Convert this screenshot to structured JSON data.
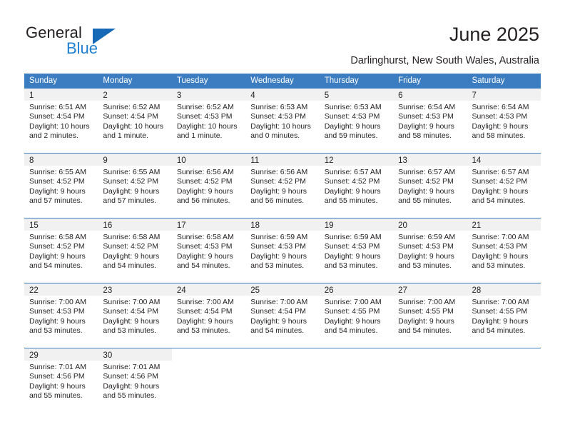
{
  "brand": {
    "name_top": "General",
    "name_bottom": "Blue",
    "accent_color": "#1669b6",
    "blue_text_color": "#1f7fd1"
  },
  "header": {
    "title": "June 2025",
    "subtitle": "Darlinghurst, New South Wales, Australia"
  },
  "calendar": {
    "header_bg": "#3b7dc0",
    "day_band_bg": "#f1f1f1",
    "weekdays": [
      "Sunday",
      "Monday",
      "Tuesday",
      "Wednesday",
      "Thursday",
      "Friday",
      "Saturday"
    ],
    "weeks": [
      [
        {
          "day": "1",
          "lines": [
            "Sunrise: 6:51 AM",
            "Sunset: 4:54 PM",
            "Daylight: 10 hours",
            "and 2 minutes."
          ]
        },
        {
          "day": "2",
          "lines": [
            "Sunrise: 6:52 AM",
            "Sunset: 4:54 PM",
            "Daylight: 10 hours",
            "and 1 minute."
          ]
        },
        {
          "day": "3",
          "lines": [
            "Sunrise: 6:52 AM",
            "Sunset: 4:53 PM",
            "Daylight: 10 hours",
            "and 1 minute."
          ]
        },
        {
          "day": "4",
          "lines": [
            "Sunrise: 6:53 AM",
            "Sunset: 4:53 PM",
            "Daylight: 10 hours",
            "and 0 minutes."
          ]
        },
        {
          "day": "5",
          "lines": [
            "Sunrise: 6:53 AM",
            "Sunset: 4:53 PM",
            "Daylight: 9 hours",
            "and 59 minutes."
          ]
        },
        {
          "day": "6",
          "lines": [
            "Sunrise: 6:54 AM",
            "Sunset: 4:53 PM",
            "Daylight: 9 hours",
            "and 58 minutes."
          ]
        },
        {
          "day": "7",
          "lines": [
            "Sunrise: 6:54 AM",
            "Sunset: 4:53 PM",
            "Daylight: 9 hours",
            "and 58 minutes."
          ]
        }
      ],
      [
        {
          "day": "8",
          "lines": [
            "Sunrise: 6:55 AM",
            "Sunset: 4:52 PM",
            "Daylight: 9 hours",
            "and 57 minutes."
          ]
        },
        {
          "day": "9",
          "lines": [
            "Sunrise: 6:55 AM",
            "Sunset: 4:52 PM",
            "Daylight: 9 hours",
            "and 57 minutes."
          ]
        },
        {
          "day": "10",
          "lines": [
            "Sunrise: 6:56 AM",
            "Sunset: 4:52 PM",
            "Daylight: 9 hours",
            "and 56 minutes."
          ]
        },
        {
          "day": "11",
          "lines": [
            "Sunrise: 6:56 AM",
            "Sunset: 4:52 PM",
            "Daylight: 9 hours",
            "and 56 minutes."
          ]
        },
        {
          "day": "12",
          "lines": [
            "Sunrise: 6:57 AM",
            "Sunset: 4:52 PM",
            "Daylight: 9 hours",
            "and 55 minutes."
          ]
        },
        {
          "day": "13",
          "lines": [
            "Sunrise: 6:57 AM",
            "Sunset: 4:52 PM",
            "Daylight: 9 hours",
            "and 55 minutes."
          ]
        },
        {
          "day": "14",
          "lines": [
            "Sunrise: 6:57 AM",
            "Sunset: 4:52 PM",
            "Daylight: 9 hours",
            "and 54 minutes."
          ]
        }
      ],
      [
        {
          "day": "15",
          "lines": [
            "Sunrise: 6:58 AM",
            "Sunset: 4:52 PM",
            "Daylight: 9 hours",
            "and 54 minutes."
          ]
        },
        {
          "day": "16",
          "lines": [
            "Sunrise: 6:58 AM",
            "Sunset: 4:52 PM",
            "Daylight: 9 hours",
            "and 54 minutes."
          ]
        },
        {
          "day": "17",
          "lines": [
            "Sunrise: 6:58 AM",
            "Sunset: 4:53 PM",
            "Daylight: 9 hours",
            "and 54 minutes."
          ]
        },
        {
          "day": "18",
          "lines": [
            "Sunrise: 6:59 AM",
            "Sunset: 4:53 PM",
            "Daylight: 9 hours",
            "and 53 minutes."
          ]
        },
        {
          "day": "19",
          "lines": [
            "Sunrise: 6:59 AM",
            "Sunset: 4:53 PM",
            "Daylight: 9 hours",
            "and 53 minutes."
          ]
        },
        {
          "day": "20",
          "lines": [
            "Sunrise: 6:59 AM",
            "Sunset: 4:53 PM",
            "Daylight: 9 hours",
            "and 53 minutes."
          ]
        },
        {
          "day": "21",
          "lines": [
            "Sunrise: 7:00 AM",
            "Sunset: 4:53 PM",
            "Daylight: 9 hours",
            "and 53 minutes."
          ]
        }
      ],
      [
        {
          "day": "22",
          "lines": [
            "Sunrise: 7:00 AM",
            "Sunset: 4:53 PM",
            "Daylight: 9 hours",
            "and 53 minutes."
          ]
        },
        {
          "day": "23",
          "lines": [
            "Sunrise: 7:00 AM",
            "Sunset: 4:54 PM",
            "Daylight: 9 hours",
            "and 53 minutes."
          ]
        },
        {
          "day": "24",
          "lines": [
            "Sunrise: 7:00 AM",
            "Sunset: 4:54 PM",
            "Daylight: 9 hours",
            "and 53 minutes."
          ]
        },
        {
          "day": "25",
          "lines": [
            "Sunrise: 7:00 AM",
            "Sunset: 4:54 PM",
            "Daylight: 9 hours",
            "and 54 minutes."
          ]
        },
        {
          "day": "26",
          "lines": [
            "Sunrise: 7:00 AM",
            "Sunset: 4:55 PM",
            "Daylight: 9 hours",
            "and 54 minutes."
          ]
        },
        {
          "day": "27",
          "lines": [
            "Sunrise: 7:00 AM",
            "Sunset: 4:55 PM",
            "Daylight: 9 hours",
            "and 54 minutes."
          ]
        },
        {
          "day": "28",
          "lines": [
            "Sunrise: 7:00 AM",
            "Sunset: 4:55 PM",
            "Daylight: 9 hours",
            "and 54 minutes."
          ]
        }
      ],
      [
        {
          "day": "29",
          "lines": [
            "Sunrise: 7:01 AM",
            "Sunset: 4:56 PM",
            "Daylight: 9 hours",
            "and 55 minutes."
          ]
        },
        {
          "day": "30",
          "lines": [
            "Sunrise: 7:01 AM",
            "Sunset: 4:56 PM",
            "Daylight: 9 hours",
            "and 55 minutes."
          ]
        },
        {
          "day": "",
          "lines": []
        },
        {
          "day": "",
          "lines": []
        },
        {
          "day": "",
          "lines": []
        },
        {
          "day": "",
          "lines": []
        },
        {
          "day": "",
          "lines": []
        }
      ]
    ]
  }
}
